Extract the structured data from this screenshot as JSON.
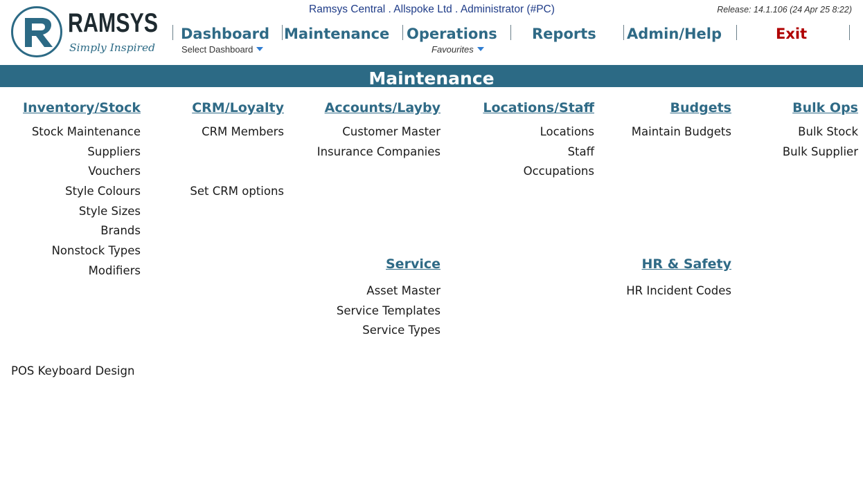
{
  "brand": {
    "name": "RAMSYS",
    "tagline": "Simply Inspired",
    "colors": {
      "primary": "#2c6a85",
      "exit": "#b00000",
      "info": "#1f3c88"
    }
  },
  "header": {
    "info": "Ramsys Central . Allspoke Ltd . Administrator (#PC)",
    "release": "Release: 14.1.106 (24 Apr 25  8:22)"
  },
  "nav": {
    "dashboard": "Dashboard",
    "maintenance": "Maintenance",
    "operations": "Operations",
    "reports": "Reports",
    "admin": "Admin/Help",
    "exit": "Exit",
    "select_dashboard": "Select Dashboard",
    "favourites": "Favourites"
  },
  "page": {
    "title": "Maintenance"
  },
  "sections": {
    "inventory": {
      "title": "Inventory/Stock",
      "items": [
        "Stock Maintenance",
        "Suppliers",
        "Vouchers",
        "Style Colours",
        "Style Sizes",
        "Brands",
        "Nonstock Types",
        "Modifiers"
      ]
    },
    "crm": {
      "title": "CRM/Loyalty",
      "items": [
        "CRM Members",
        "Set CRM options"
      ]
    },
    "accounts": {
      "title": "Accounts/Layby",
      "items": [
        "Customer Master",
        "Insurance Companies"
      ]
    },
    "locations": {
      "title": "Locations/Staff",
      "items": [
        "Locations",
        "Staff",
        "Occupations"
      ]
    },
    "budgets": {
      "title": "Budgets",
      "items": [
        "Maintain Budgets"
      ]
    },
    "bulk": {
      "title": "Bulk Ops",
      "items": [
        "Bulk Stock",
        "Bulk Supplier"
      ]
    },
    "service": {
      "title": "Service",
      "items": [
        "Asset Master",
        "Service Templates",
        "Service Types"
      ]
    },
    "hr": {
      "title": "HR & Safety",
      "items": [
        "HR Incident Codes"
      ]
    },
    "pos": {
      "label": "POS Keyboard Design"
    }
  }
}
